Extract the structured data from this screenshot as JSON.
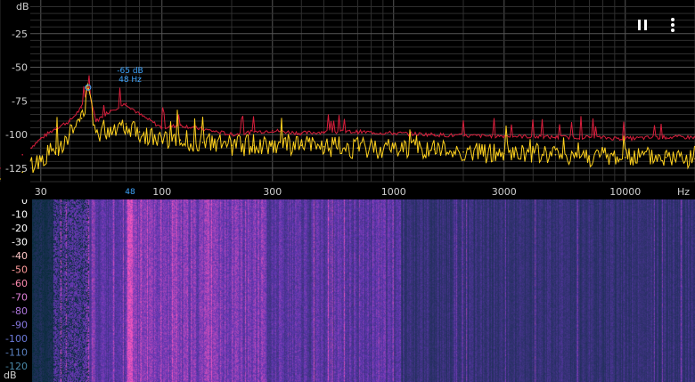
{
  "controls": {
    "pause_icon": "pause-icon",
    "menu_icon": "more-vert-icon"
  },
  "colors": {
    "live": "#ffd21e",
    "peak_hold": "#d81e3c",
    "peak_marker": "#3fa6ff",
    "grid": "#2e2e2e",
    "spectrogram_bg": "#0b2f3a"
  },
  "spectrum": {
    "db_unit": "dB",
    "db_ticks": [
      "-25",
      "-50",
      "-75",
      "-100",
      "-125"
    ],
    "db_range": [
      -135,
      0
    ],
    "freq_unit": "Hz",
    "freq_ticks": [
      "30",
      "100",
      "300",
      "1000",
      "3000",
      "10000"
    ],
    "freq_range": [
      20,
      20000
    ],
    "peak": {
      "level": "-65 dB",
      "freq": "48 Hz",
      "axis_marker": "48"
    }
  },
  "chart_data": {
    "type": "line",
    "ylabel": "dB",
    "xlabel": "Hz",
    "xscale": "log",
    "xlim": [
      20,
      20000
    ],
    "ylim": [
      -135,
      0
    ],
    "series": [
      {
        "x": [
          20,
          25,
          30,
          35,
          40,
          45,
          48,
          52,
          60,
          70,
          80,
          100,
          120,
          150,
          200,
          250,
          300,
          400,
          500,
          700,
          1000,
          1500,
          2000,
          3000,
          5000,
          7000,
          10000,
          15000,
          20000
        ],
        "y": [
          -125,
          -115,
          -103,
          -95,
          -90,
          -80,
          -65,
          -90,
          -82,
          -77,
          -85,
          -95,
          -93,
          -96,
          -100,
          -98,
          -97,
          -99,
          -98,
          -98,
          -99,
          -100,
          -101,
          -101,
          -102,
          -102,
          -103,
          -102,
          -102
        ]
      },
      {
        "x": [
          20,
          25,
          30,
          35,
          40,
          45,
          48,
          52,
          60,
          70,
          80,
          100,
          120,
          150,
          200,
          250,
          300,
          400,
          500,
          700,
          1000,
          1500,
          2000,
          3000,
          5000,
          7000,
          10000,
          15000,
          20000
        ],
        "y": [
          -133,
          -128,
          -118,
          -110,
          -100,
          -88,
          -66,
          -98,
          -95,
          -92,
          -98,
          -105,
          -104,
          -106,
          -108,
          -108,
          -107,
          -108,
          -109,
          -110,
          -110,
          -111,
          -113,
          -114,
          -115,
          -116,
          -117,
          -117,
          -118
        ]
      }
    ]
  },
  "spectrogram": {
    "db_ticks": [
      "0",
      "-10",
      "-20",
      "-30",
      "-40",
      "-50",
      "-60",
      "-70",
      "-80",
      "-90",
      "-100",
      "-110",
      "-120"
    ],
    "db_unit": "dB",
    "tick_colors": [
      "#ffffff",
      "#ffffff",
      "#ffffff",
      "#ffffff",
      "#ffc8c8",
      "#ff9a9a",
      "#ff8ab0",
      "#e080d8",
      "#b078e0",
      "#8878e0",
      "#6a78d8",
      "#5a80c0",
      "#4a88a8"
    ]
  }
}
